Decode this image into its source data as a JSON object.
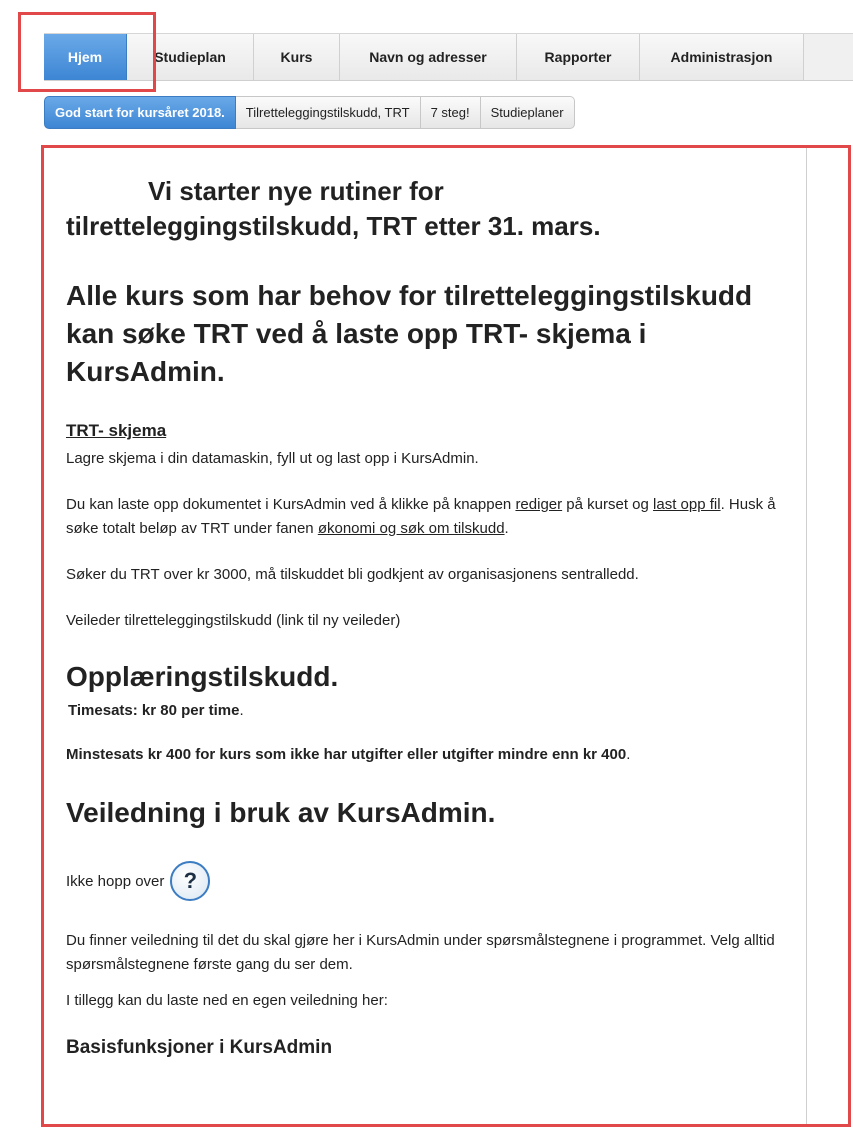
{
  "nav": {
    "tabs": [
      {
        "label": "Hjem",
        "active": true
      },
      {
        "label": "Studieplan",
        "active": false
      },
      {
        "label": "Kurs",
        "active": false
      },
      {
        "label": "Navn og adresser",
        "active": false
      },
      {
        "label": "Rapporter",
        "active": false
      },
      {
        "label": "Administrasjon",
        "active": false
      }
    ]
  },
  "subnav": {
    "items": [
      {
        "label": "God start for kursåret 2018.",
        "active": true
      },
      {
        "label": "Tilretteleggingstilskudd, TRT",
        "active": false
      },
      {
        "label": "7 steg!",
        "active": false
      },
      {
        "label": "Studieplaner",
        "active": false
      }
    ]
  },
  "content": {
    "heading1_line1": "Vi starter nye rutiner for",
    "heading1_line2": "tilretteleggingstilskudd, TRT etter 31. mars.",
    "heading2": "Alle kurs som har behov for tilretteleggingstilskudd kan søke TRT ved å laste opp TRT- skjema i KursAdmin.",
    "trt_link": "TRT- skjema",
    "p_save": "Lagre skjema i din datamaskin, fyll ut og last opp i KursAdmin.",
    "p_upload_1": "Du kan laste opp dokumentet i KursAdmin ved å klikke på knappen ",
    "p_upload_link1": "rediger",
    "p_upload_2": " på kurset og ",
    "p_upload_link2": "last opp fil",
    "p_upload_3": ". Husk å søke totalt beløp av TRT under fanen ",
    "p_upload_link3": "økonomi og søk om tilskudd",
    "p_upload_4": ".",
    "p_over3000": "Søker du TRT over kr 3000, må tilskuddet bli godkjent av organisasjonens sentralledd.",
    "p_veileder": "Veileder tilretteleggingstilskudd (link til ny veileder)",
    "section_training": "Opplæringstilskudd.",
    "training_rate": "Timesats: kr 80 per time",
    "training_rate_end": ".",
    "training_min": "Minstesats kr 400 for kurs som ikke har utgifter eller utgifter mindre enn kr 400",
    "training_min_end": ".",
    "section_guide": "Veiledning i bruk av KursAdmin.",
    "skip_text": "Ikke hopp over",
    "help_symbol": "?",
    "p_guide": "Du finner veiledning til det du skal gjøre her i KursAdmin under spørsmålstegnene i programmet. Velg alltid spørsmålstegnene første gang du ser dem.",
    "p_download": "I tillegg kan du laste ned en egen veiledning her:",
    "last_heading": "Basisfunksjoner i KursAdmin"
  },
  "colors": {
    "accent": "#3d86d4",
    "highlight": "#e0484a"
  }
}
